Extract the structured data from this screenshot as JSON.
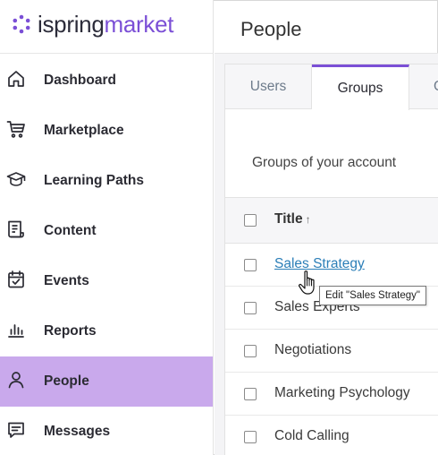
{
  "brand": {
    "name_part1": "ispring",
    "name_part2": "market",
    "accent_color": "#7b4fd6",
    "active_nav_color": "#c9a9ec"
  },
  "sidebar": {
    "items": [
      {
        "label": "Dashboard",
        "icon": "home-icon",
        "active": false
      },
      {
        "label": "Marketplace",
        "icon": "cart-icon",
        "active": false
      },
      {
        "label": "Learning Paths",
        "icon": "graduation-cap-icon",
        "active": false
      },
      {
        "label": "Content",
        "icon": "document-list-icon",
        "active": false
      },
      {
        "label": "Events",
        "icon": "calendar-check-icon",
        "active": false
      },
      {
        "label": "Reports",
        "icon": "bar-chart-icon",
        "active": false
      },
      {
        "label": "People",
        "icon": "person-icon",
        "active": true
      },
      {
        "label": "Messages",
        "icon": "message-icon",
        "active": false
      }
    ]
  },
  "header": {
    "title": "People"
  },
  "tabs": [
    {
      "label": "Users",
      "active": false
    },
    {
      "label": "Groups",
      "active": true
    },
    {
      "label": "C",
      "active": false
    }
  ],
  "main": {
    "section_title": "Groups of your account",
    "table": {
      "column_title": "Title",
      "sort_indicator": "↑",
      "rows": [
        {
          "title": "Sales Strategy",
          "hovered": true
        },
        {
          "title": "Sales Experts",
          "hovered": false
        },
        {
          "title": "Negotiations",
          "hovered": false
        },
        {
          "title": "Marketing Psychology",
          "hovered": false
        },
        {
          "title": "Cold Calling",
          "hovered": false
        }
      ]
    },
    "tooltip": "Edit \"Sales Strategy\""
  }
}
